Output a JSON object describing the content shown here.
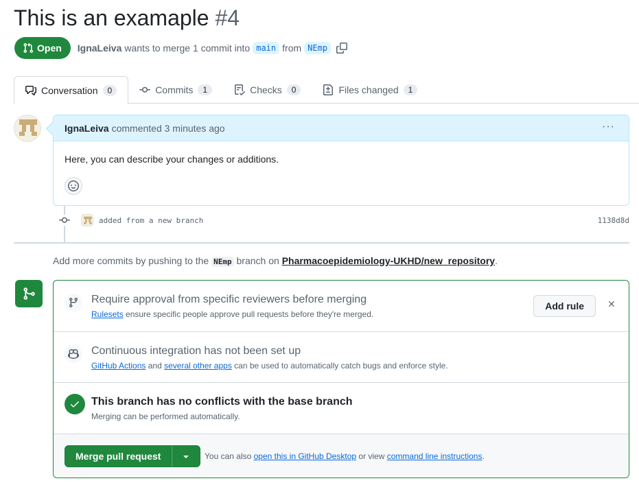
{
  "pr": {
    "title": "This is an examaple",
    "number": "#4",
    "state": "Open",
    "author": "IgnaLeiva",
    "merge_text": "wants to merge 1 commit into",
    "base_branch": "main",
    "from_text": "from",
    "head_branch": "NEmp"
  },
  "tabs": [
    {
      "label": "Conversation",
      "count": "0",
      "icon": "comment-discussion-icon"
    },
    {
      "label": "Commits",
      "count": "1",
      "icon": "git-commit-icon"
    },
    {
      "label": "Checks",
      "count": "0",
      "icon": "checklist-icon"
    },
    {
      "label": "Files changed",
      "count": "1",
      "icon": "file-diff-icon"
    }
  ],
  "comment": {
    "author": "IgnaLeiva",
    "meta": "commented 3 minutes ago",
    "body": "Here, you can describe your changes or additions.",
    "menu": "···"
  },
  "commit": {
    "message": "added from a new branch",
    "sha": "1138d8d"
  },
  "push_note": {
    "prefix": "Add more commits by pushing to the",
    "branch": "NEmp",
    "middle": "branch on",
    "repo": "Pharmacoepidemiology-UKHD/new_repository",
    "suffix": "."
  },
  "merge_box": {
    "rule": {
      "title": "Require approval from specific reviewers before merging",
      "link": "Rulesets",
      "text": "ensure specific people approve pull requests before they're merged.",
      "button": "Add rule"
    },
    "ci": {
      "title": "Continuous integration has not been set up",
      "link1": "GitHub Actions",
      "and": "and",
      "link2": "several other apps",
      "text": "can be used to automatically catch bugs and enforce style."
    },
    "conflicts": {
      "title": "This branch has no conflicts with the base branch",
      "text": "Merging can be performed automatically."
    },
    "merge": {
      "button": "Merge pull request",
      "note_prefix": "You can also",
      "link1": "open this in GitHub Desktop",
      "or_view": "or view",
      "link2": "command line instructions",
      "suffix": "."
    }
  },
  "colors": {
    "green": "#1f883d",
    "link": "#0969da",
    "comment_header": "#ddf4ff"
  }
}
